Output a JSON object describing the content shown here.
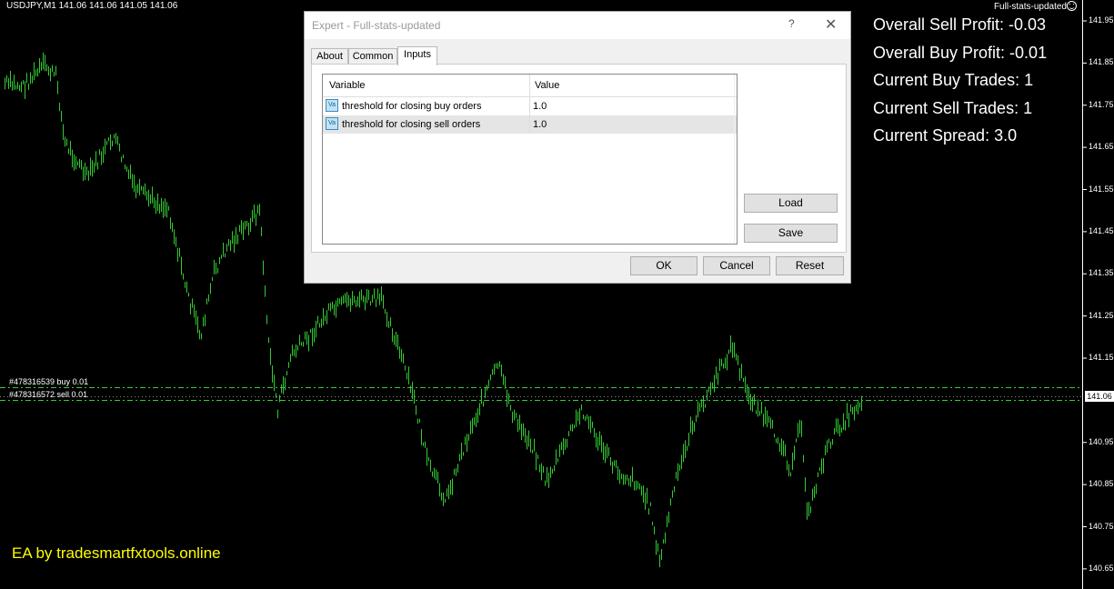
{
  "chart": {
    "symbol_title": "USDJPY,M1  141.06 141.06 141.05 141.06",
    "ea_name": "Full-stats-updated",
    "ea_credit": "EA by tradesmartfxtools.online",
    "current_price": "141.06",
    "price_axis": [
      "141.95",
      "141.85",
      "141.75",
      "141.65",
      "141.55",
      "141.45",
      "141.35",
      "141.25",
      "141.15",
      "140.95",
      "140.85",
      "140.75",
      "140.65"
    ],
    "orders": {
      "buy": "#478316539 buy 0.01",
      "sell": "#478316572 sell 0.01"
    },
    "colors": {
      "background": "#000000",
      "bars": "#33cc33",
      "order_line": "#33cc33",
      "credit": "#ffff00"
    }
  },
  "stats": {
    "overall_sell_profit": "Overall Sell Profit: -0.03",
    "overall_buy_profit": "Overall Buy Profit: -0.01",
    "current_buy_trades": "Current Buy Trades: 1",
    "current_sell_trades": "Current Sell Trades: 1",
    "current_spread": "Current Spread: 3.0"
  },
  "dialog": {
    "title": "Expert - Full-stats-updated",
    "help": "?",
    "close": "✕",
    "tabs": [
      "About",
      "Common",
      "Inputs"
    ],
    "active_tab": "Inputs",
    "grid": {
      "headers": [
        "Variable",
        "Value"
      ],
      "rows": [
        {
          "icon": "Va",
          "name": "threshold for closing buy orders",
          "value": "1.0"
        },
        {
          "icon": "Va",
          "name": "threshold for closing sell orders",
          "value": "1.0"
        }
      ]
    },
    "buttons": {
      "load": "Load",
      "save": "Save",
      "ok": "OK",
      "cancel": "Cancel",
      "reset": "Reset"
    }
  }
}
